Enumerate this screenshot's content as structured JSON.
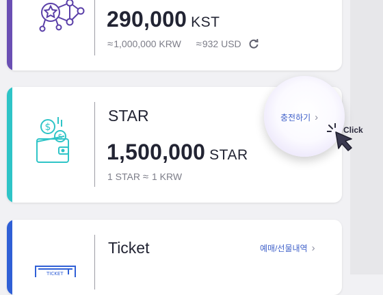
{
  "cards": {
    "kst": {
      "amount": "290,000",
      "unit": "KST",
      "approx_symbol": "≈",
      "krw": "1,000,000 KRW",
      "usd": "932 USD",
      "icon": "network-star-icon",
      "accent": "#6a4fb3",
      "refresh_icon": "refresh-icon"
    },
    "star": {
      "title": "STAR",
      "amount": "1,500,000",
      "unit": "STAR",
      "rate_left": "1 STAR",
      "approx_symbol": "≈",
      "rate_right": "1 KRW",
      "charge_link": "충전하기",
      "icon": "wallet-coin-icon",
      "accent": "#2ec4c7"
    },
    "ticket": {
      "title": "Ticket",
      "history_link": "예매/선물내역",
      "icon": "ticket-icon",
      "accent": "#2f5fd6"
    }
  },
  "overlay": {
    "click_label": "Click",
    "cursor_icon": "pointer-cursor-icon"
  },
  "colors": {
    "link": "#3f60c9",
    "text": "#222433",
    "muted": "#7c7d88"
  }
}
